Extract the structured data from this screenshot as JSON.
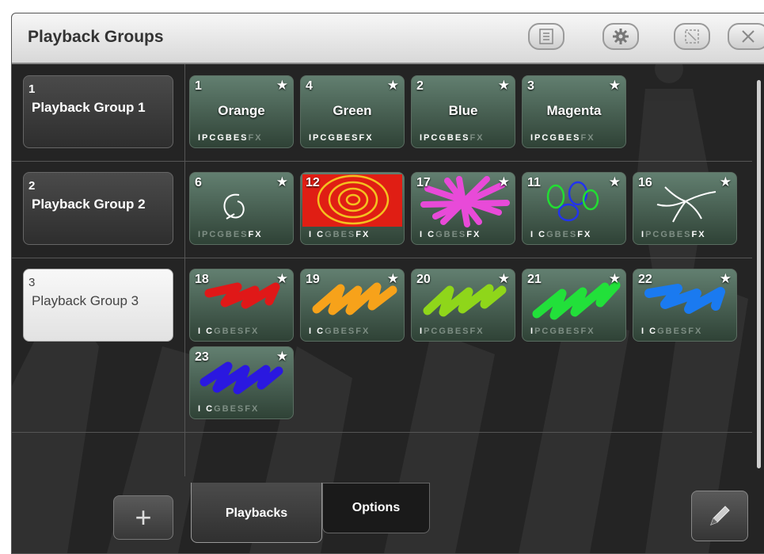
{
  "window": {
    "title": "Playback Groups",
    "toolbar_icons": [
      "list-icon",
      "gear-icon",
      "resize-icon",
      "close-icon"
    ]
  },
  "groups": [
    {
      "number": "1",
      "name": "Playback Group 1",
      "selected": false
    },
    {
      "number": "2",
      "name": "Playback Group 2",
      "selected": false
    },
    {
      "number": "3",
      "name": "Playback Group 3",
      "selected": true
    }
  ],
  "playbacks": {
    "group1": [
      {
        "number": "1",
        "name": "Orange",
        "flags_on": "IPCGBES",
        "flags_off": "FX"
      },
      {
        "number": "4",
        "name": "Green",
        "flags_on": "IPCGBESFX",
        "flags_off": ""
      },
      {
        "number": "2",
        "name": "Blue",
        "flags_on": "IPCGBES",
        "flags_off": "FX"
      },
      {
        "number": "3",
        "name": "Magenta",
        "flags_on": "IPCGBES",
        "flags_off": "FX"
      }
    ],
    "group2": [
      {
        "number": "6",
        "flags_on_pre": "",
        "flags_off": "IPCGBES",
        "flags_on": "FX",
        "art": "circle"
      },
      {
        "number": "12",
        "flags_on_pre": "I C",
        "flags_off": "GBES",
        "flags_on": "FX",
        "art": "spiral"
      },
      {
        "number": "17",
        "flags_on_pre": "I C",
        "flags_off": "GBES",
        "flags_on": "FX",
        "art": "pinkburst"
      },
      {
        "number": "11",
        "flags_on_pre": "I C",
        "flags_off": "GBES",
        "flags_on": "FX",
        "art": "loops"
      },
      {
        "number": "16",
        "flags_on_pre": "I",
        "flags_off": "PCGBES",
        "flags_on": "FX",
        "art": "curves"
      }
    ],
    "group3": [
      {
        "number": "18",
        "flags_on_pre": "I C",
        "flags_off": "GBESFX",
        "color": "#e01818"
      },
      {
        "number": "19",
        "flags_on_pre": "I C",
        "flags_off": "GBESFX",
        "color": "#f7a21a"
      },
      {
        "number": "20",
        "flags_on_pre": "I",
        "flags_off": "PCGBESFX",
        "color": "#8fd61a"
      },
      {
        "number": "21",
        "flags_on_pre": "I",
        "flags_off": "PCGBESFX",
        "color": "#22e03a"
      },
      {
        "number": "22",
        "flags_on_pre": "I C",
        "flags_off": "GBESFX",
        "color": "#1a7af0"
      },
      {
        "number": "23",
        "flags_on_pre": "I C",
        "flags_off": "GBESFX",
        "color": "#2a18e0"
      }
    ]
  },
  "tabs": [
    {
      "label": "Playbacks",
      "active": true
    },
    {
      "label": "Options",
      "active": false
    }
  ],
  "add_label": "+",
  "colors": {
    "tile_top": "#627f70",
    "tile_bottom": "#2f4236",
    "background": "#242424"
  }
}
